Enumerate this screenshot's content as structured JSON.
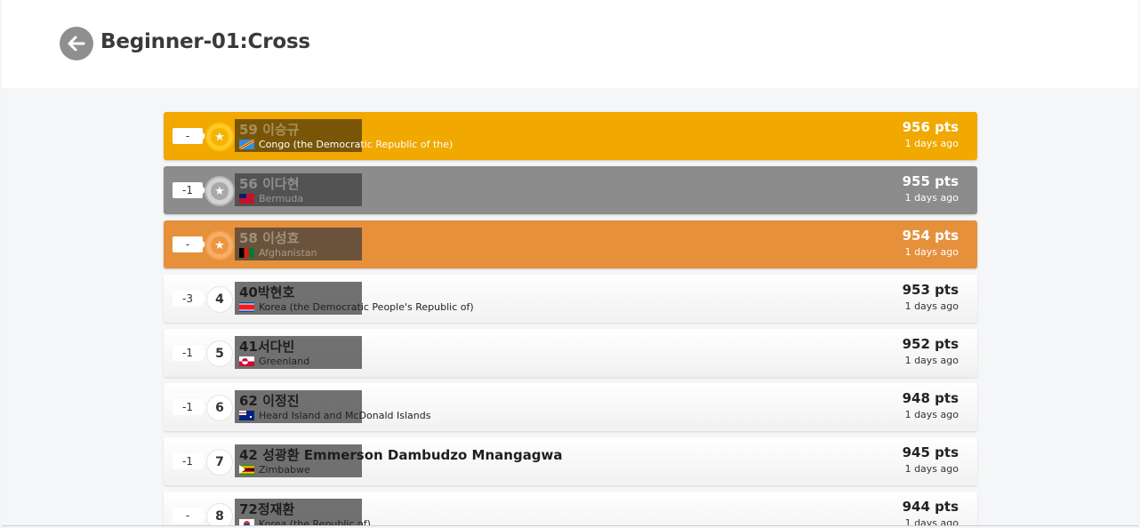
{
  "header": {
    "title": "Beginner-01:Cross",
    "back_icon": "arrow-left-icon"
  },
  "leaderboard": [
    {
      "change": "-",
      "rank": "1",
      "medal": "gold",
      "name": "59 이승규",
      "country": "Congo (the Democratic Republic of the)",
      "flag": "flag-congo-drc",
      "points": "956 pts",
      "ago": "1 days ago"
    },
    {
      "change": "-1",
      "rank": "2",
      "medal": "silver",
      "name": "56 이다현",
      "country": "Bermuda",
      "flag": "flag-bermuda",
      "points": "955 pts",
      "ago": "1 days ago"
    },
    {
      "change": "-",
      "rank": "3",
      "medal": "bronze",
      "name": "58 이성효",
      "country": "Afghanistan",
      "flag": "flag-afghanistan",
      "points": "954 pts",
      "ago": "1 days ago"
    },
    {
      "change": "-3",
      "rank": "4",
      "name": "40박현호",
      "country": "Korea (the Democratic People's Republic of)",
      "flag": "flag-north-korea",
      "points": "953 pts",
      "ago": "1 days ago"
    },
    {
      "change": "-1",
      "rank": "5",
      "name": "41서다빈",
      "country": "Greenland",
      "flag": "flag-greenland",
      "points": "952 pts",
      "ago": "1 days ago"
    },
    {
      "change": "-1",
      "rank": "6",
      "name": "62 이정진",
      "country": "Heard Island and McDonald Islands",
      "flag": "flag-heard-island",
      "points": "948 pts",
      "ago": "1 days ago"
    },
    {
      "change": "-1",
      "rank": "7",
      "name": "42 성광환 Emmerson Dambudzo Mnangagwa",
      "country": "Zimbabwe",
      "flag": "flag-zimbabwe",
      "points": "945 pts",
      "ago": "1 days ago"
    },
    {
      "change": "-",
      "rank": "8",
      "name": "72정재환",
      "country": "Korea (the Republic of)",
      "flag": "flag-south-korea",
      "points": "944 pts",
      "ago": "1 days ago"
    }
  ],
  "colors": {
    "gold": "#f1a800",
    "silver": "#8c8c8c",
    "bronze": "#e7903c"
  }
}
